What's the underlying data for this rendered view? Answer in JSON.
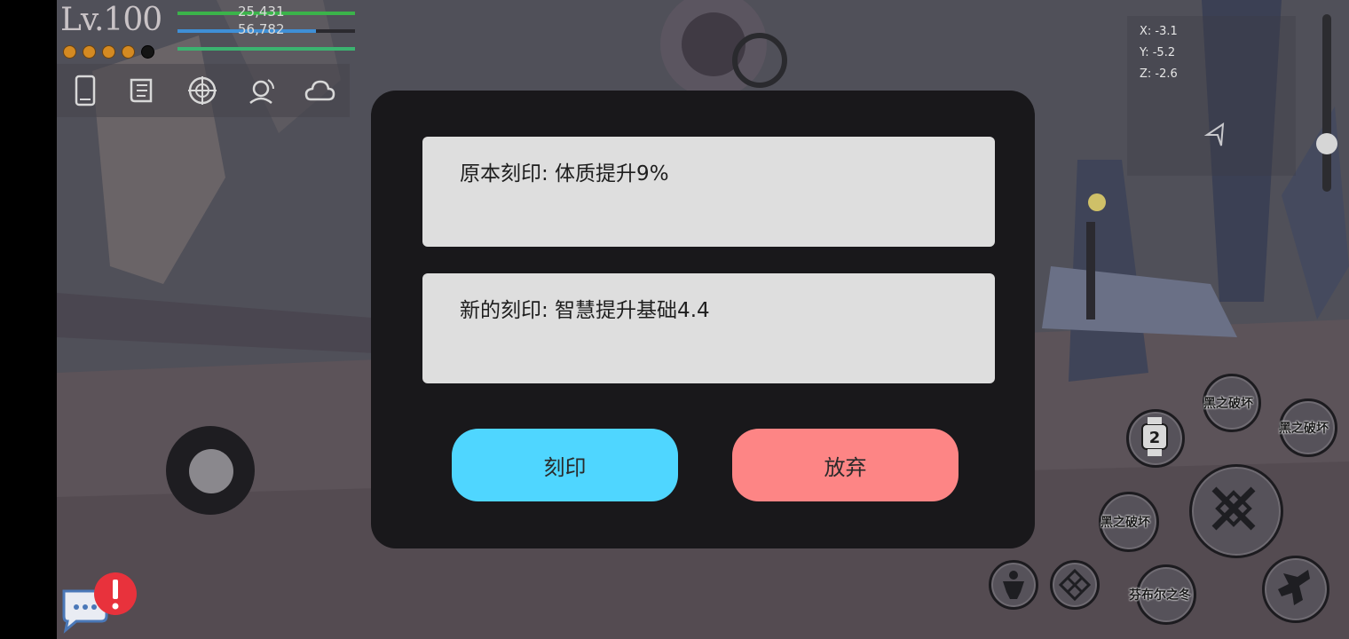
{
  "hud": {
    "level": "Lv.100",
    "hp_value": "25,431",
    "mp_value": "56,782",
    "hp_fraction": 1.0,
    "mp_fraction": 0.78,
    "xp_fraction": 1.0,
    "charge_pips": [
      true,
      true,
      true,
      true,
      false
    ],
    "menu_icons": [
      "phone-icon",
      "scroll-icon",
      "target-icon",
      "headset-icon",
      "cloud-icon"
    ],
    "coords": {
      "x": "X: -3.1",
      "y": "Y: -5.2",
      "z": "Z: -2.6"
    }
  },
  "dialog": {
    "original_engraving": "原本刻印: 体质提升9%",
    "new_engraving": "新的刻印: 智慧提升基础4.4",
    "engrave_button": "刻印",
    "discard_button": "放弃"
  },
  "skills": {
    "skill_a": "黑之破坏",
    "skill_b": "黑之破坏",
    "skill_c": "黑之破坏",
    "skill_d": "芬布尔之冬",
    "watch_badge": "2"
  },
  "colors": {
    "engrave": "#4fd6ff",
    "discard": "#fd8585",
    "hp": "#3bb34a",
    "mp": "#3f8fd6",
    "dialog_bg": "#19181b",
    "alert": "#e8323c"
  }
}
